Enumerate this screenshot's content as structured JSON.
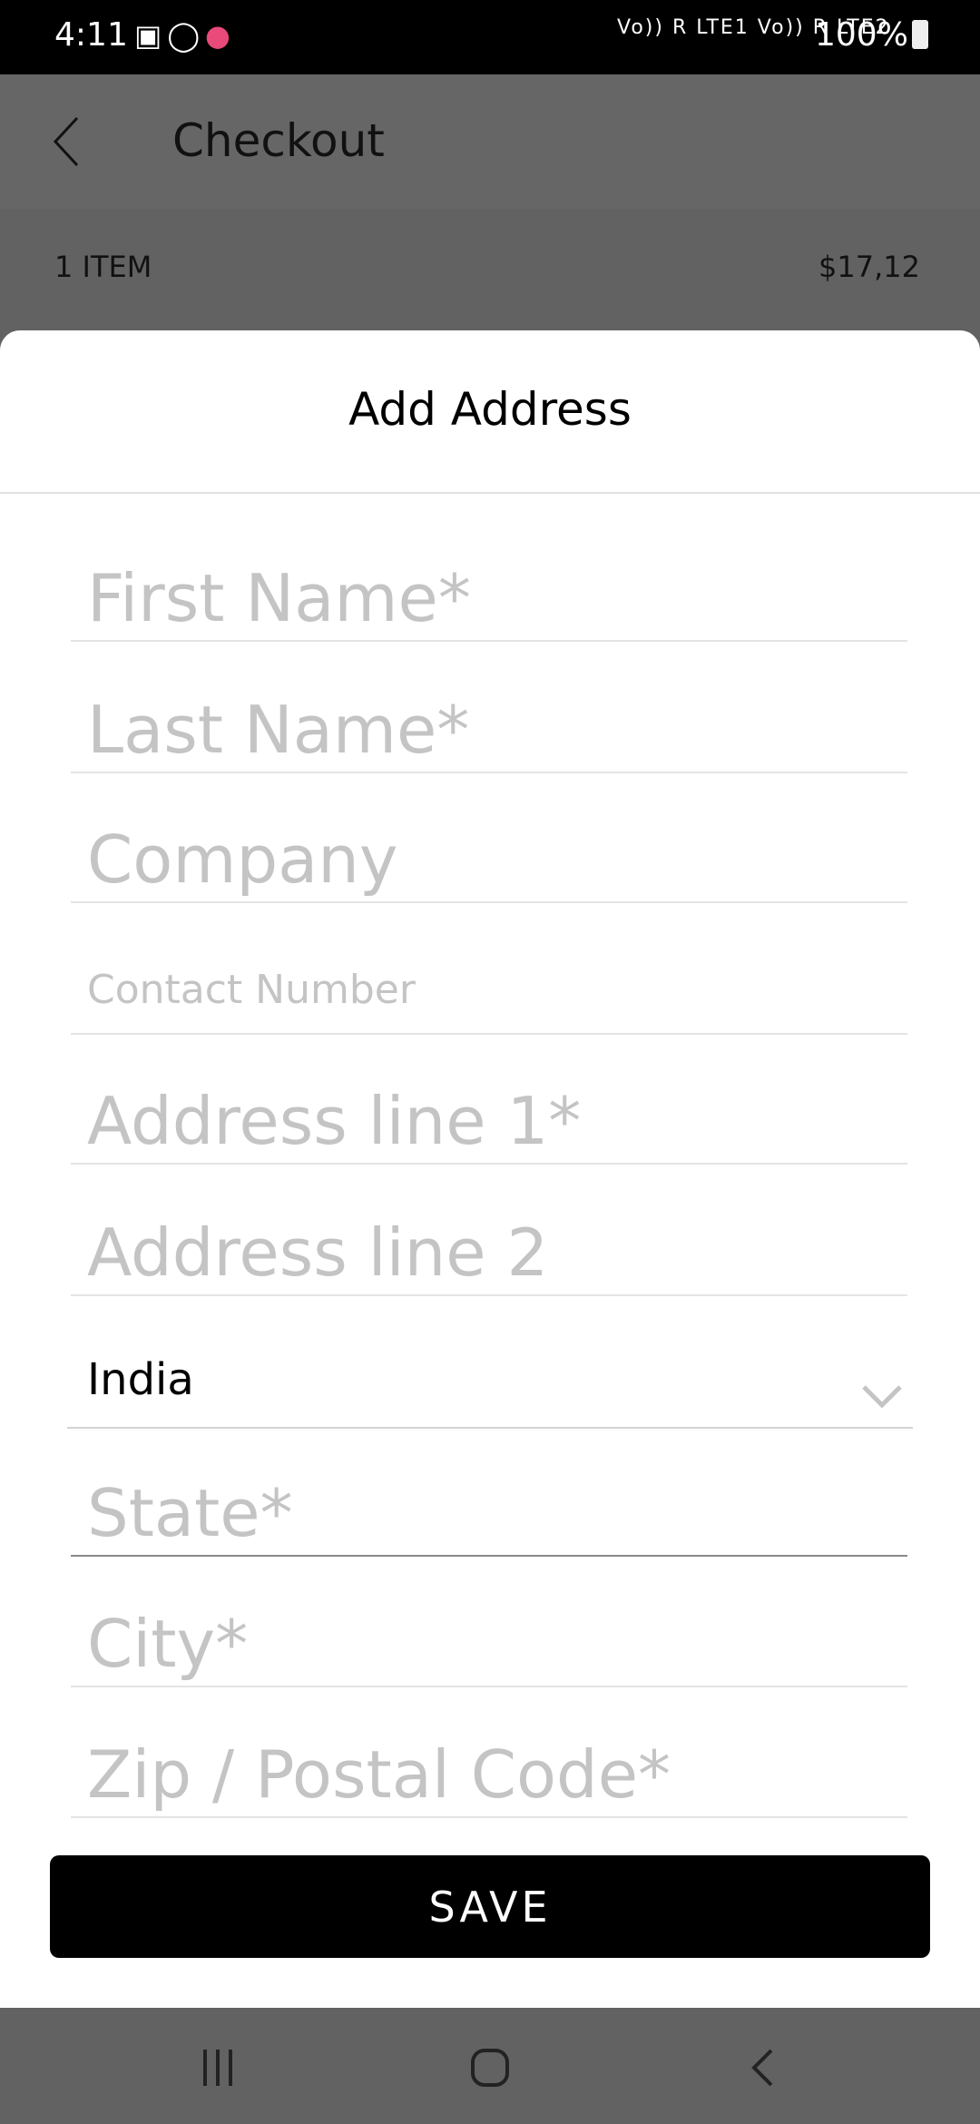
{
  "status_bar": {
    "time": "4:11",
    "apps": [
      "teams-icon",
      "whatsapp-icon",
      "app-icon"
    ],
    "network": "Vo)) R LTE1 Vo)) R LTE2",
    "battery": "100%"
  },
  "toolbar": {
    "title": "Checkout"
  },
  "summary": {
    "count": "1 ITEM",
    "total": "$17,12"
  },
  "sheet": {
    "title": "Add Address",
    "fields": [
      {
        "placeholder": "First Name*",
        "value": ""
      },
      {
        "placeholder": "Last Name*",
        "value": ""
      },
      {
        "placeholder": "Company",
        "value": ""
      },
      {
        "placeholder": "Contact Number",
        "value": ""
      },
      {
        "placeholder": "Address line 1*",
        "value": ""
      },
      {
        "placeholder": "Address line 2",
        "value": ""
      }
    ],
    "country": "India",
    "fields2": [
      {
        "placeholder": "State*",
        "value": ""
      },
      {
        "placeholder": "City*",
        "value": ""
      },
      {
        "placeholder": "Zip / Postal Code*",
        "value": ""
      }
    ],
    "save_label": "SAVE"
  }
}
